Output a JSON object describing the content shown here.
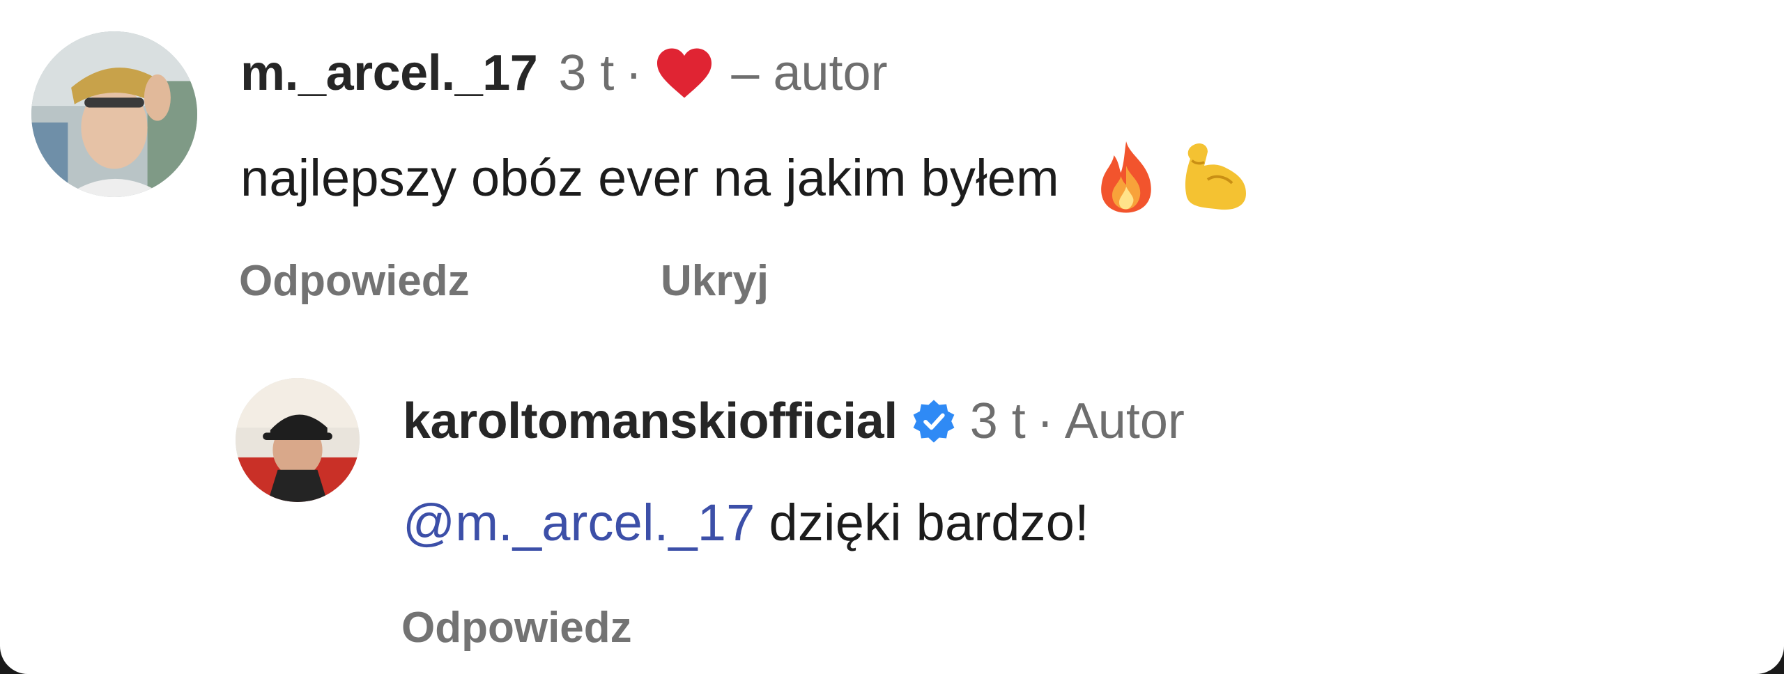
{
  "comment": {
    "username": "m._arcel._17",
    "time": "3 t",
    "dot": "·",
    "liked_by_author_label": "– autor",
    "text": "najlepszy obóz ever na jakim byłem",
    "emojis": [
      "fire-emoji",
      "flexed-biceps-emoji"
    ],
    "actions": {
      "reply": "Odpowiedz",
      "hide": "Ukryj"
    }
  },
  "reply": {
    "username": "karoltomanskiofficial",
    "verified": true,
    "time": "3 t",
    "dot": "·",
    "author_label": "Autor",
    "mention": "@m._arcel._17",
    "text": "dzięki bardzo!",
    "actions": {
      "reply": "Odpowiedz"
    }
  },
  "colors": {
    "heart": "#e02433",
    "verified_badge": "#2f8af5",
    "mention": "#3c4fa8",
    "meta_text": "#6e6e6e",
    "action_text": "#737373"
  }
}
